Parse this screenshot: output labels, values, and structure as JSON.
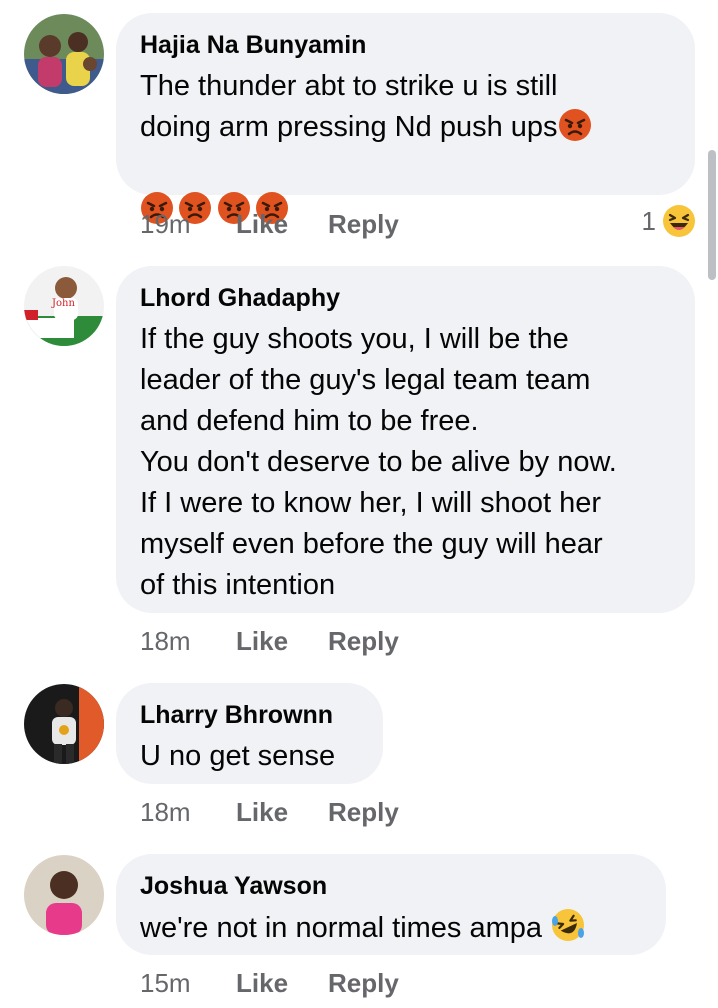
{
  "comments": [
    {
      "author": "Hajia Na Bunyamin",
      "line1": "The thunder abt to strike u is still",
      "line2": "doing arm pressing Nd push ups",
      "emoji": "angry-face-icon",
      "time": "19m",
      "like": "Like",
      "reply": "Reply",
      "reaction_count": "1",
      "reaction_icon": "laughing-face-icon"
    },
    {
      "author": "Lhord Ghadaphy",
      "text": "If the guy shoots you, I will be the\nleader of the guy's legal team team\nand defend him to be free.\nYou don't deserve to be alive by now.\nIf I were to know her, I will shoot her\nmyself even before the guy will hear\nof this intention",
      "time": "18m",
      "like": "Like",
      "reply": "Reply"
    },
    {
      "author": "Lharry Bhrownn",
      "text": "U no get sense",
      "time": "18m",
      "like": "Like",
      "reply": "Reply"
    },
    {
      "author": "Joshua Yawson",
      "text": "we're not in normal times ampa",
      "emoji": "rolling-laughing-face-icon",
      "time": "15m",
      "like": "Like",
      "reply": "Reply"
    }
  ],
  "colors": {
    "bubble": "#f0f2f5",
    "meta_text": "#65676b",
    "name_text": "#050505"
  }
}
